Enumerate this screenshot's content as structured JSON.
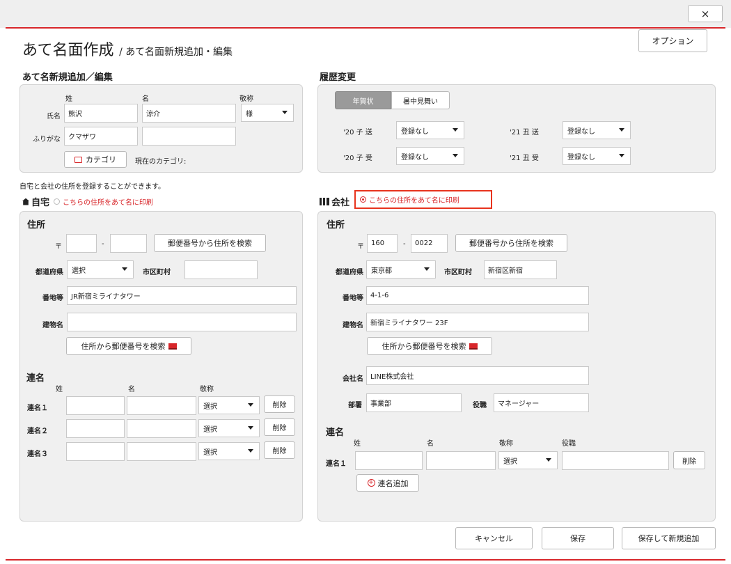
{
  "dialog": {
    "close_label": "×",
    "title": "あて名面作成",
    "subtitle": "/ あて名面新規追加・編集",
    "options_label": "オプション"
  },
  "newedit": {
    "heading": "あて名新規追加／編集",
    "col_last": "姓",
    "col_first": "名",
    "col_honorific": "敬称",
    "name_label": "氏名",
    "last_name": "熊沢",
    "first_name": "涼介",
    "honorific": "様",
    "kana_label": "ふりがな",
    "kana_last": "クマザワ",
    "kana_first": "",
    "category_button": "カテゴリ",
    "current_category": "現在のカテゴリ:"
  },
  "history": {
    "heading": "履歴変更",
    "tabs": [
      "年賀状",
      "暑中見舞い"
    ],
    "rows": [
      {
        "label": "'20 子 送",
        "value": "登録なし"
      },
      {
        "label": "'20 子 受",
        "value": "登録なし"
      },
      {
        "label": "'21 丑 送",
        "value": "登録なし"
      },
      {
        "label": "'21 丑 受",
        "value": "登録なし"
      }
    ]
  },
  "note": "自宅と会社の住所を登録することができます。",
  "home": {
    "title": "自宅",
    "print_option": "こちらの住所をあて名に印刷",
    "address_heading": "住所",
    "postal_mark": "〒",
    "postal1": "",
    "postal_sep": "-",
    "postal2": "",
    "postal_search": "郵便番号から住所を検索",
    "pref_label": "都道府県",
    "pref_value": "選択",
    "city_label": "市区町村",
    "city_value": "",
    "street_label": "番地等",
    "street_value": "JR新宿ミライナタワー",
    "building_label": "建物名",
    "building_value": "",
    "addr_search": "住所から郵便番号を検索",
    "joint_heading": "連名",
    "joint_col_last": "姓",
    "joint_col_first": "名",
    "joint_col_honorific": "敬称",
    "joint_rows": [
      {
        "label": "連名１",
        "honorific": "選択",
        "delete": "削除"
      },
      {
        "label": "連名２",
        "honorific": "選択",
        "delete": "削除"
      },
      {
        "label": "連名３",
        "honorific": "選択",
        "delete": "削除"
      }
    ]
  },
  "company": {
    "title": "会社",
    "print_option": "こちらの住所をあて名に印刷",
    "address_heading": "住所",
    "postal_mark": "〒",
    "postal1": "160",
    "postal_sep": "-",
    "postal2": "0022",
    "postal_search": "郵便番号から住所を検索",
    "pref_label": "都道府県",
    "pref_value": "東京都",
    "city_label": "市区町村",
    "city_value": "新宿区新宿",
    "street_label": "番地等",
    "street_value": "4-1-6",
    "building_label": "建物名",
    "building_value": "新宿ミライナタワー 23F",
    "addr_search": "住所から郵便番号を検索",
    "company_label": "会社名",
    "company_value": "LINE株式会社",
    "dept_label": "部署",
    "dept_value": "事業部",
    "role_label": "役職",
    "role_value": "マネージャー",
    "joint_heading": "連名",
    "joint_col_last": "姓",
    "joint_col_first": "名",
    "joint_col_honorific": "敬称",
    "joint_col_role": "役職",
    "joint_rows": [
      {
        "label": "連名１",
        "honorific": "選択",
        "delete": "削除"
      }
    ],
    "add_joint": "連名追加"
  },
  "footer": {
    "cancel": "キャンセル",
    "save": "保存",
    "save_new": "保存して新規追加"
  },
  "colors": {
    "accent": "#d8262a",
    "panel": "#f0f0f0",
    "tab_active": "#9a9a9a"
  }
}
